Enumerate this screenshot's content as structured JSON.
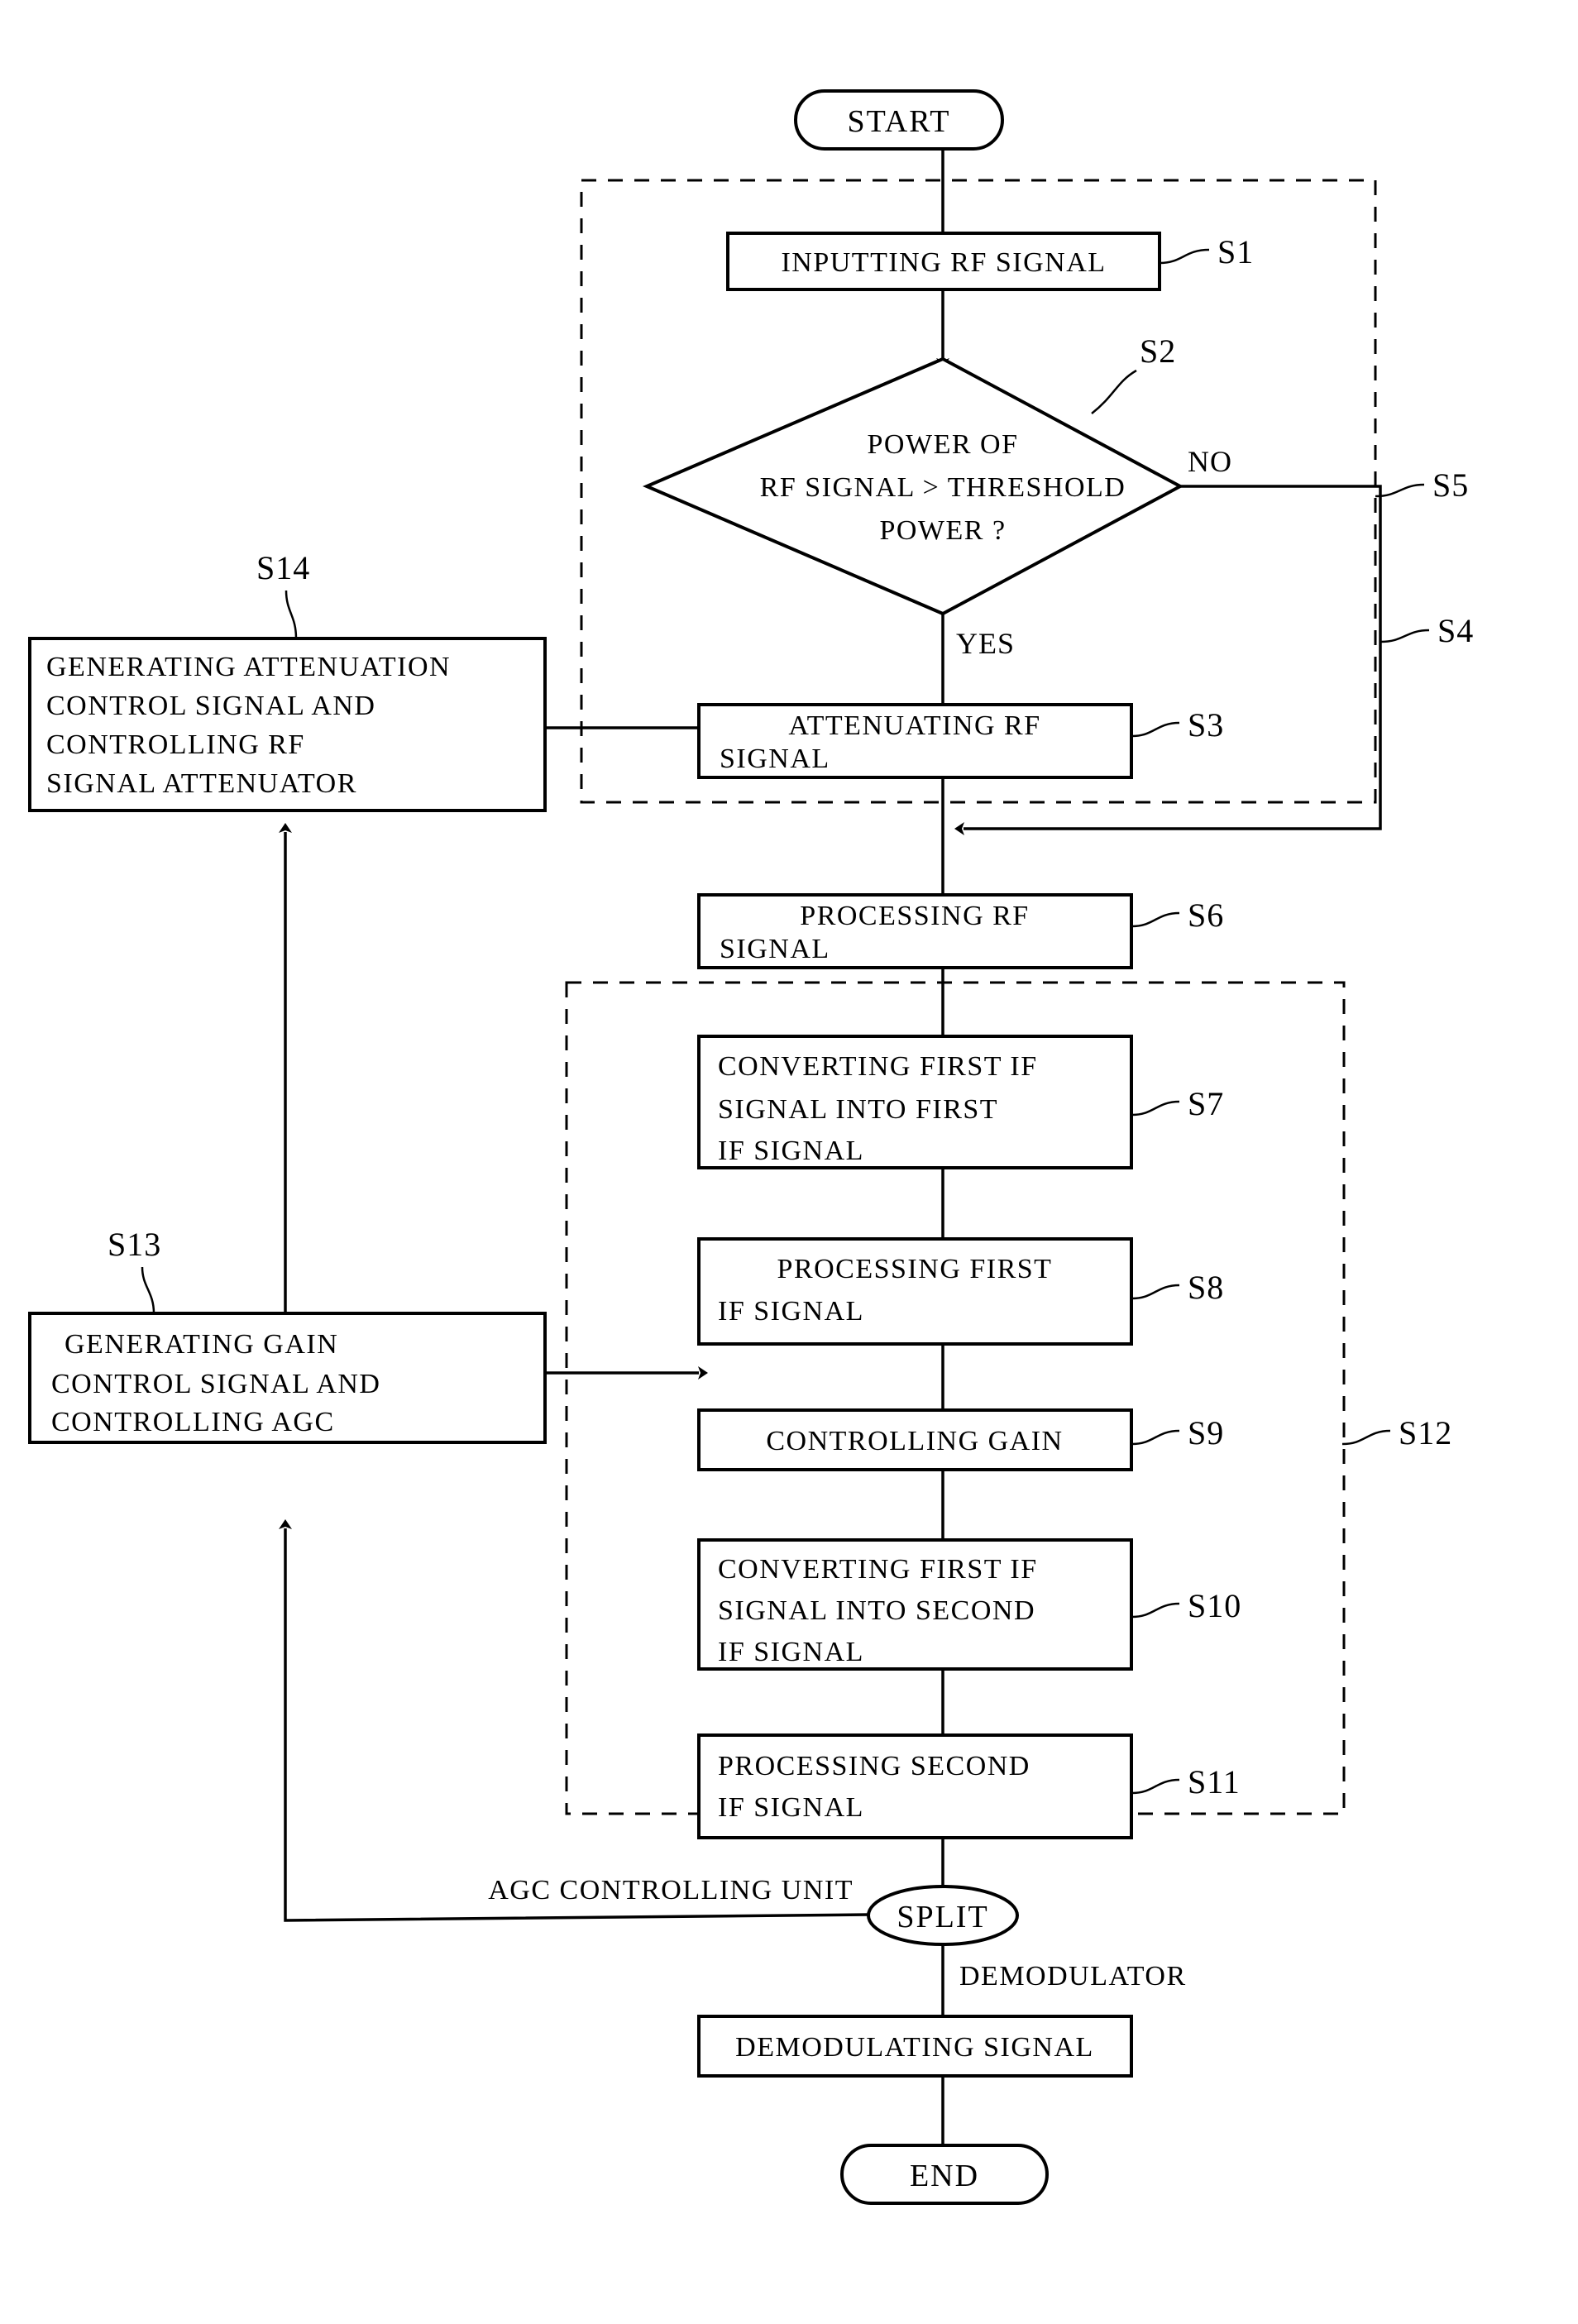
{
  "diagram": {
    "type": "flowchart",
    "title": "",
    "nodes": {
      "start": {
        "label": "START",
        "shape": "terminator"
      },
      "s1": {
        "label": "INPUTTING RF SIGNAL",
        "ref": "S1",
        "shape": "process"
      },
      "s2": {
        "lines": [
          "POWER OF",
          "RF SIGNAL > THRESHOLD",
          "POWER ?"
        ],
        "ref": "S2",
        "shape": "decision"
      },
      "s3": {
        "lines": [
          "ATTENUATING  RF",
          "SIGNAL"
        ],
        "ref": "S3",
        "shape": "process"
      },
      "s6": {
        "lines": [
          "PROCESSING  RF",
          "SIGNAL"
        ],
        "ref": "S6",
        "shape": "process"
      },
      "s7": {
        "lines": [
          "CONVERTING  FIRST  IF",
          "SIGNAL  INTO  FIRST",
          "IF SIGNAL"
        ],
        "ref": "S7",
        "shape": "process"
      },
      "s8": {
        "lines": [
          "PROCESSING  FIRST",
          "IF SIGNAL"
        ],
        "ref": "S8",
        "shape": "process"
      },
      "s9": {
        "lines": [
          "CONTROLLING  GAIN"
        ],
        "ref": "S9",
        "shape": "process"
      },
      "s10": {
        "lines": [
          "CONVERTING  FIRST  IF",
          "SIGNAL  INTO  SECOND",
          "IF SIGNAL"
        ],
        "ref": "S10",
        "shape": "process"
      },
      "s11": {
        "lines": [
          "PROCESSING  SECOND",
          "IF SIGNAL"
        ],
        "ref": "S11",
        "shape": "process"
      },
      "s13": {
        "lines": [
          "GENERATING  GAIN",
          "CONTROL SIGNAL AND",
          "CONTROLLING AGC"
        ],
        "ref": "S13",
        "shape": "process"
      },
      "s14": {
        "lines": [
          "GENERATING ATTENUATION",
          "CONTROL SIGNAL AND",
          "CONTROLLING RF",
          "SIGNAL ATTENUATOR"
        ],
        "ref": "S14",
        "shape": "process"
      },
      "split": {
        "label": "SPLIT",
        "shape": "connector"
      },
      "demod": {
        "label": "DEMODULATING SIGNAL",
        "shape": "process"
      },
      "end": {
        "label": "END",
        "shape": "terminator"
      }
    },
    "group_refs": {
      "s4": "S4",
      "s5": "S5",
      "s12": "S12"
    },
    "edge_labels": {
      "no": "NO",
      "yes": "YES",
      "agc_unit": "AGC CONTROLLING UNIT",
      "demodulator": "DEMODULATOR"
    },
    "colors": {
      "stroke": "#000000",
      "fill": "#ffffff"
    }
  }
}
